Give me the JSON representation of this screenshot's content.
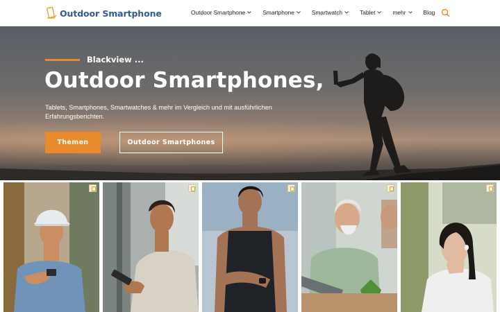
{
  "header": {
    "logo_text": "Outdoor Smartphone",
    "nav": [
      {
        "label": "Outdoor Smartphone",
        "has_dropdown": true
      },
      {
        "label": "Smartphone",
        "has_dropdown": true
      },
      {
        "label": "Smartwatch",
        "has_dropdown": true
      },
      {
        "label": "Tablet",
        "has_dropdown": true
      },
      {
        "label": "mehr",
        "has_dropdown": true
      },
      {
        "label": "Blog",
        "has_dropdown": false
      }
    ],
    "search_icon": "search-icon"
  },
  "hero": {
    "kicker": "Blackview ...",
    "title": "Outdoor Smartphones,",
    "subtitle": "Tablets, Smartphones, Smartwatches & mehr im Vergleich und mit ausführlichen Erfahrungsberichten.",
    "primary_button": "Themen",
    "secondary_button": "Outdoor Smartphones"
  },
  "colors": {
    "accent": "#e98a2c",
    "brand": "#2f5b9a"
  },
  "gallery": {
    "photos": [
      "worker-with-hardhat-phone",
      "man-looking-at-phone",
      "man-checking-smartwatch",
      "older-men-with-tablet",
      "woman-with-earbuds"
    ]
  }
}
